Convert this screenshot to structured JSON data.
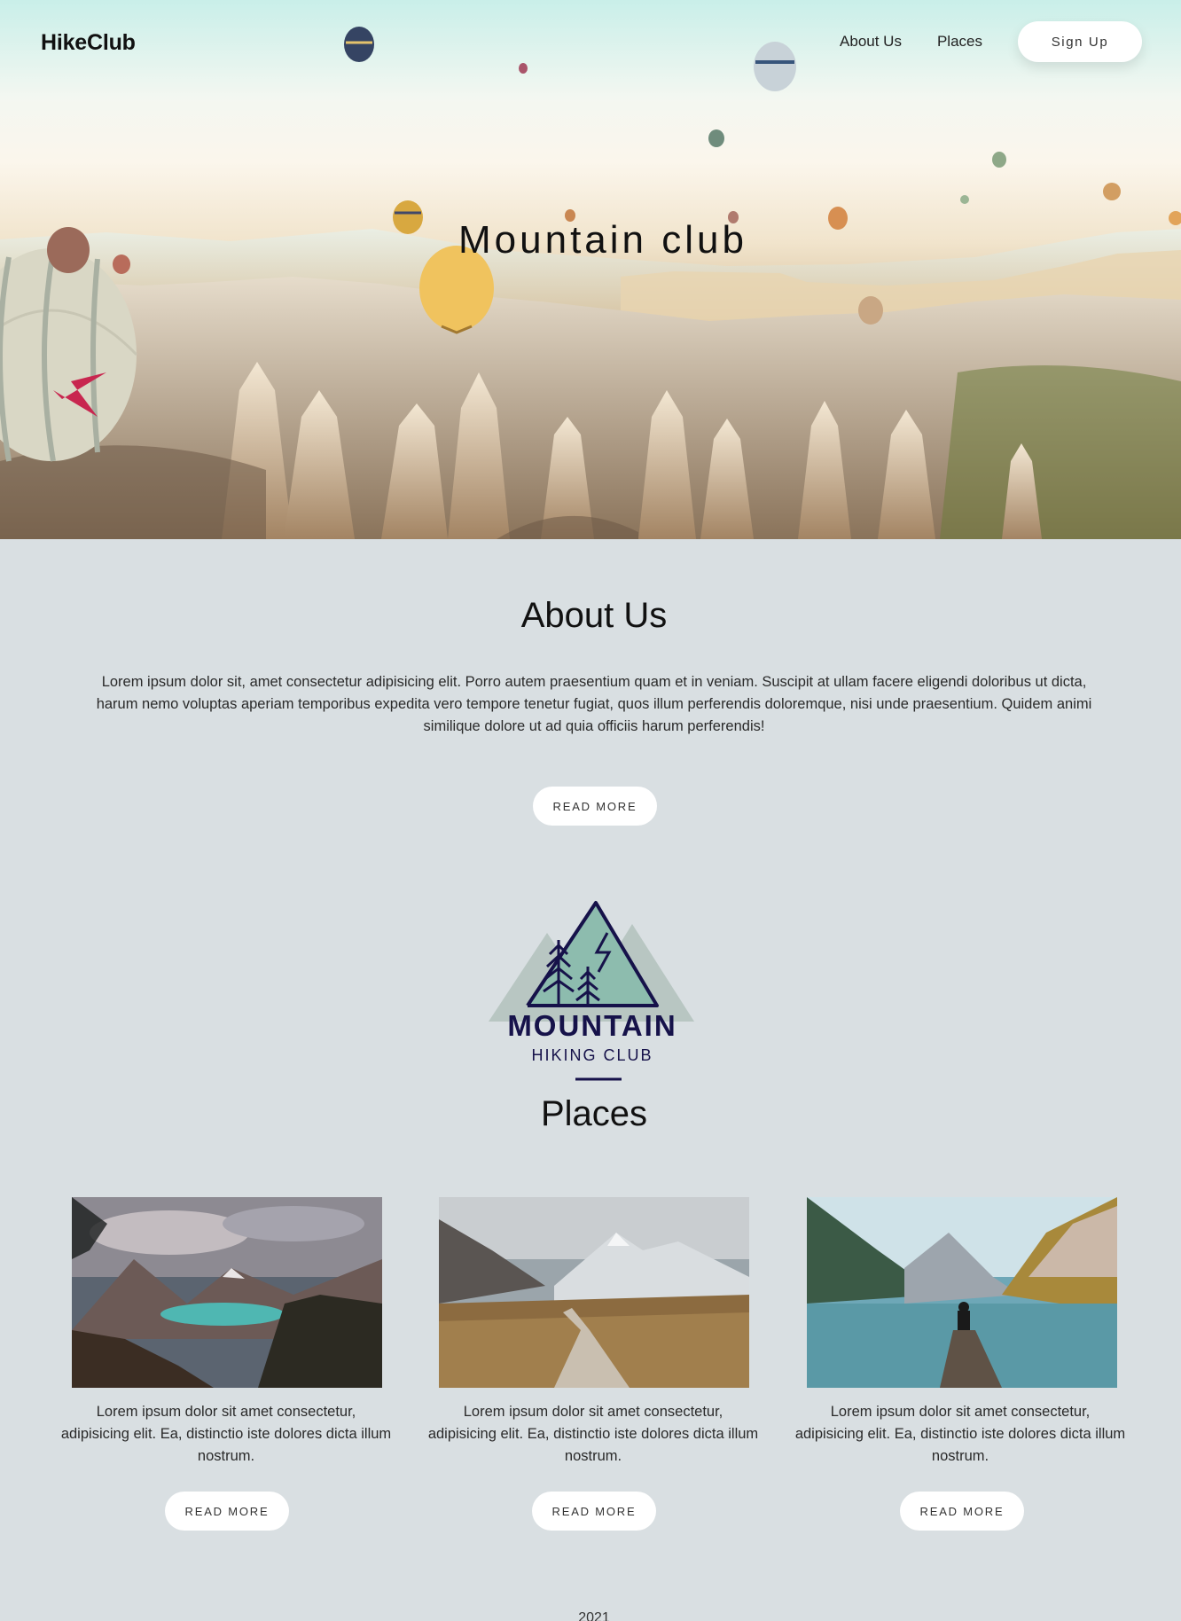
{
  "header": {
    "brand": "HikeClub",
    "nav": [
      "About Us",
      "Places"
    ],
    "signup_label": "Sign Up"
  },
  "hero": {
    "title": "Mountain club"
  },
  "about": {
    "title": "About Us",
    "text": "Lorem ipsum dolor sit, amet consectetur adipisicing elit. Porro autem praesentium quam et in veniam. Suscipit at ullam facere eligendi doloribus ut dicta, harum nemo voluptas aperiam temporibus expedita vero tempore tenetur fugiat, quos illum perferendis doloremque, nisi unde praesentium. Quidem animi similique dolore ut ad quia officiis harum perferendis!",
    "button_label": "READ MORE"
  },
  "logo": {
    "line1": "MOUNTAIN",
    "line2": "HIKING CLUB"
  },
  "places": {
    "title": "Places",
    "cards": [
      {
        "image": "mountain-lake-forest",
        "text": "Lorem ipsum dolor sit amet consectetur, adipisicing elit. Ea, distinctio iste dolores dicta illum nostrum.",
        "button_label": "READ MORE"
      },
      {
        "image": "boardwalk-trail-valley",
        "text": "Lorem ipsum dolor sit amet consectetur, adipisicing elit. Ea, distinctio iste dolores dicta illum nostrum.",
        "button_label": "READ MORE"
      },
      {
        "image": "dock-lake-person",
        "text": "Lorem ipsum dolor sit amet consectetur, adipisicing elit. Ea, distinctio iste dolores dicta illum nostrum.",
        "button_label": "READ MORE"
      }
    ]
  },
  "footer": {
    "year": "2021"
  },
  "colors": {
    "page_bg": "#d9dfe2",
    "logo_navy": "#16124a",
    "logo_teal": "#8dbcae",
    "logo_grey": "#b8c6c2"
  }
}
